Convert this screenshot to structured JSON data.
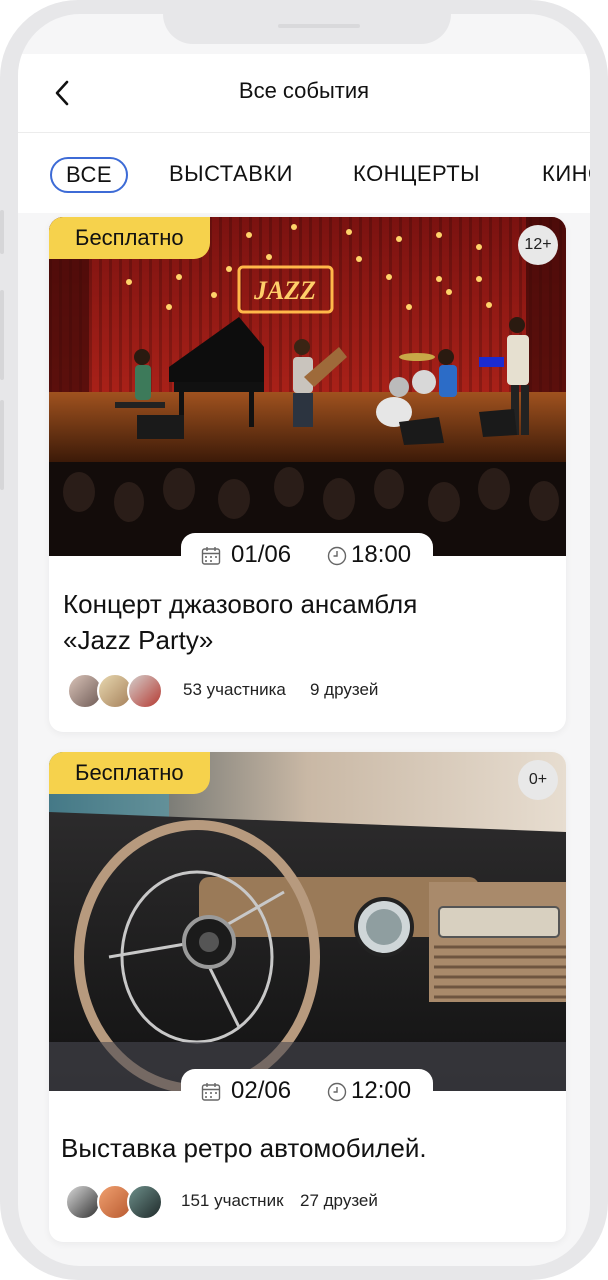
{
  "header": {
    "title": "Все события"
  },
  "tabs": [
    {
      "label": "ВСЕ",
      "active": true
    },
    {
      "label": "ВЫСТАВКИ",
      "active": false
    },
    {
      "label": "КОНЦЕРТЫ",
      "active": false
    },
    {
      "label": "КИНО",
      "active": false
    }
  ],
  "events": [
    {
      "badge": "Бесплатно",
      "age": "12+",
      "date": "01/06",
      "time": "18:00",
      "title_line1": "Концерт джазового ансамбля",
      "title_line2": " «Jazz Party»",
      "sign_text": "JAZZ",
      "participants": "53 участника",
      "friends": "9 друзей"
    },
    {
      "badge": "Бесплатно",
      "age": "0+",
      "date": "02/06",
      "time": "12:00",
      "title_line1": "Выставка ретро автомобилей.",
      "participants": "151 участник",
      "friends": "27 друзей"
    }
  ],
  "colors": {
    "badge": "#f6d24c",
    "active_tab_border": "#3d6bd6",
    "background": "#f6f6f7"
  },
  "icons": [
    "back-arrow-icon",
    "calendar-icon",
    "clock-icon"
  ]
}
